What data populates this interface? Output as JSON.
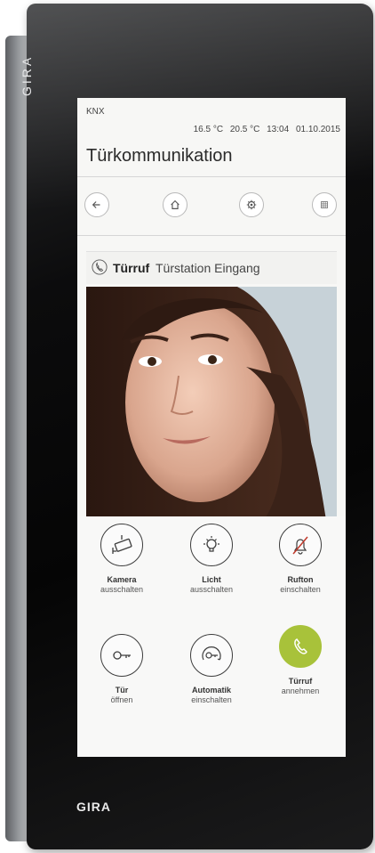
{
  "device": {
    "brand_side": "GIRA",
    "brand_bottom": "GIRA",
    "accent_color": "#a8c23a"
  },
  "status": {
    "bus": "KNX",
    "temp_outside": "16.5 °C",
    "temp_inside": "20.5 °C",
    "time": "13:04",
    "date": "01.10.2015"
  },
  "page": {
    "title": "Türkommunikation"
  },
  "nav": {
    "icons": [
      "back-arrow-icon",
      "home-icon",
      "settings-gear-icon",
      "grid-icon"
    ]
  },
  "call": {
    "title": "Türruf",
    "subtitle": "Türstation Eingang",
    "icon": "phone-handset-icon"
  },
  "controls": [
    {
      "label": "Kamera",
      "sub": "ausschalten",
      "icon": "camera-icon"
    },
    {
      "label": "Licht",
      "sub": "ausschalten",
      "icon": "light-bulb-icon"
    },
    {
      "label": "Rufton",
      "sub": "einschalten",
      "icon": "bell-muted-icon"
    },
    {
      "label": "Tür",
      "sub": "öffnen",
      "icon": "key-icon"
    },
    {
      "label": "Automatik",
      "sub": "einschalten",
      "icon": "automatic-key-icon"
    },
    {
      "label": "Türruf",
      "sub": "annehmen",
      "icon": "phone-accept-icon"
    }
  ]
}
